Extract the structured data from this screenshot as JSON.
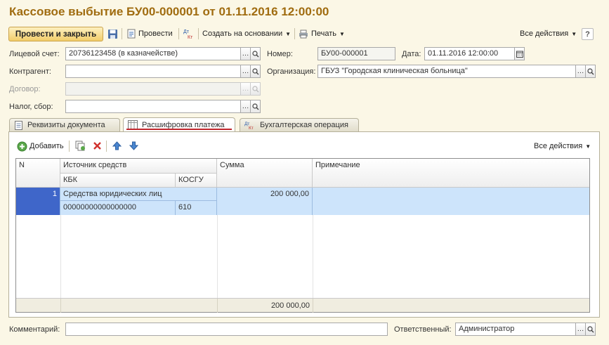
{
  "window": {
    "title": "Кассовое выбытие БУ00-000001 от 01.11.2016 12:00:00"
  },
  "toolbar": {
    "post_close_label": "Провести и закрыть",
    "post_label": "Провести",
    "create_based_label": "Создать на основании",
    "print_label": "Печать",
    "all_actions_label": "Все действия"
  },
  "form": {
    "account_label": "Лицевой счет:",
    "account_value": "20736123458 (в казначействе)",
    "number_label": "Номер:",
    "number_value": "БУ00-000001",
    "date_label": "Дата:",
    "date_value": "01.11.2016 12:00:00",
    "counterparty_label": "Контрагент:",
    "counterparty_value": "",
    "organization_label": "Организация:",
    "organization_value": "ГБУЗ \"Городская клиническая больница\"",
    "contract_label": "Договор:",
    "contract_value": "",
    "tax_label": "Налог, сбор:",
    "tax_value": ""
  },
  "tabs": [
    {
      "label": "Реквизиты документа"
    },
    {
      "label": "Расшифровка платежа"
    },
    {
      "label": "Бухгалтерская операция"
    }
  ],
  "table_toolbar": {
    "add_label": "Добавить",
    "all_actions_label": "Все действия"
  },
  "table": {
    "headers": {
      "n": "N",
      "source": "Источник средств",
      "kbk": "КБК",
      "kosgu": "КОСГУ",
      "sum": "Сумма",
      "note": "Примечание"
    },
    "rows": [
      {
        "n": "1",
        "source": "Средства юридических лиц",
        "kbk": "00000000000000000",
        "kosgu": "610",
        "sum": "200 000,00",
        "note": ""
      }
    ],
    "footer_total": "200 000,00"
  },
  "bottom": {
    "comment_label": "Комментарий:",
    "comment_value": "",
    "responsible_label": "Ответственный:",
    "responsible_value": "Администратор"
  },
  "colors": {
    "title": "#a06c10",
    "primary_button": "#f2cd6a",
    "selected_row": "#cde4fb",
    "selected_cell": "#3f66c9",
    "background": "#fbf7e6"
  }
}
